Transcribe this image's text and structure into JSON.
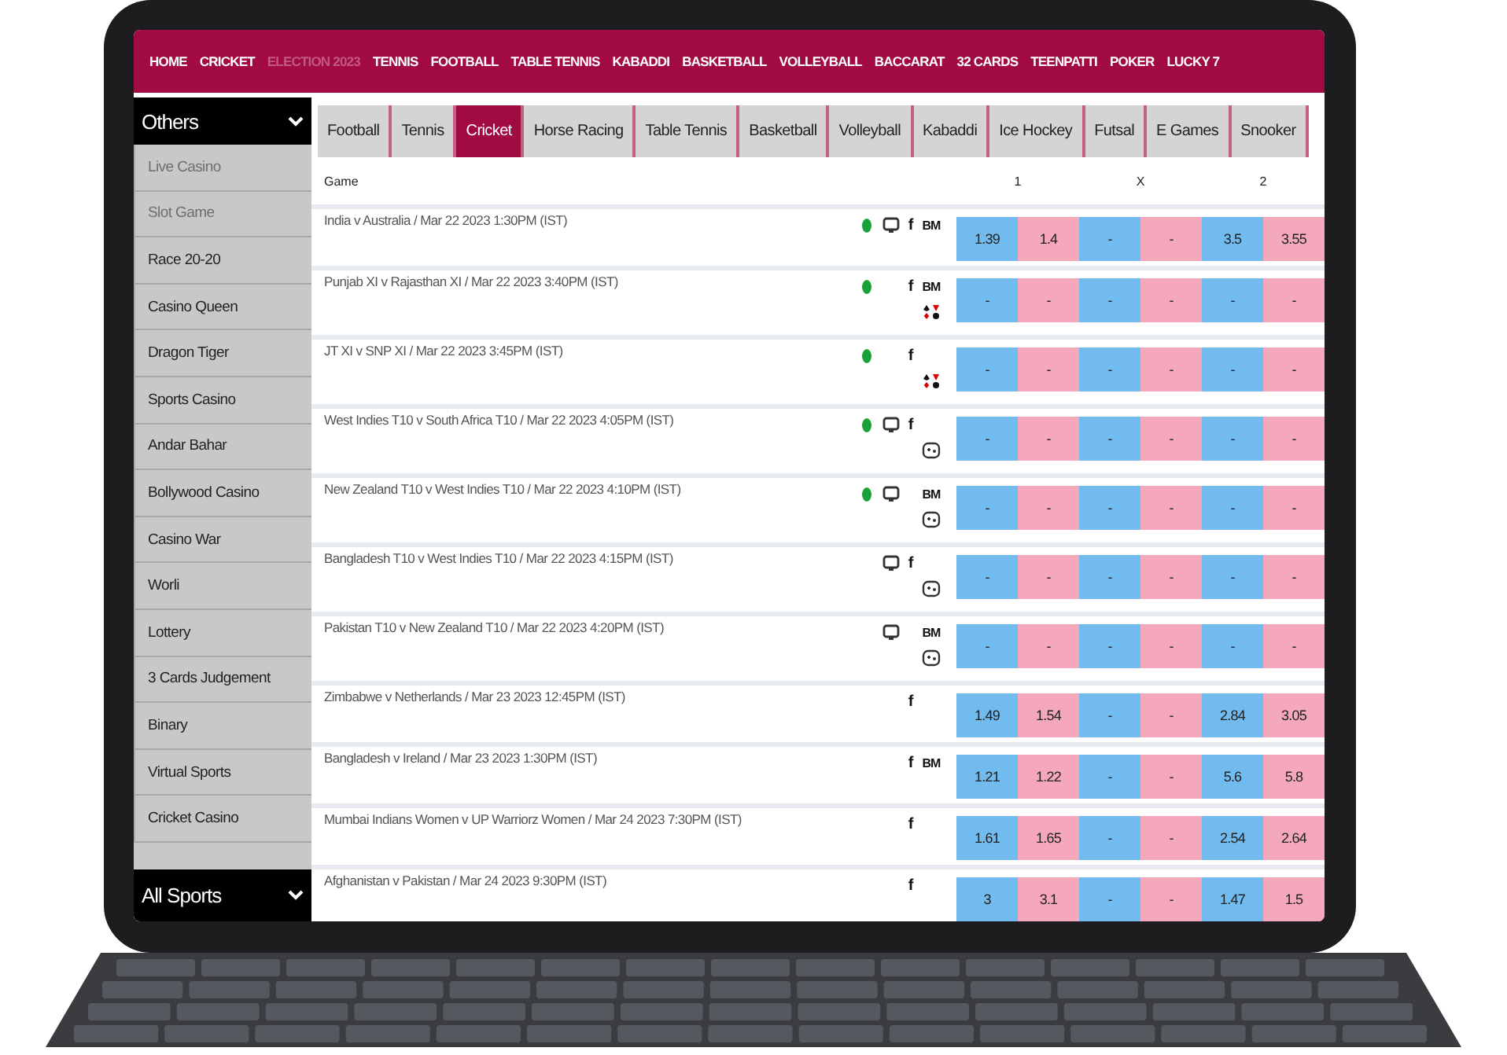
{
  "nav": [
    {
      "label": "HOME",
      "disabled": false
    },
    {
      "label": "CRICKET",
      "disabled": false
    },
    {
      "label": "ELECTION 2023",
      "disabled": true
    },
    {
      "label": "TENNIS",
      "disabled": false
    },
    {
      "label": "FOOTBALL",
      "disabled": false
    },
    {
      "label": "TABLE TENNIS",
      "disabled": false
    },
    {
      "label": "KABADDI",
      "disabled": false
    },
    {
      "label": "BASKETBALL",
      "disabled": false
    },
    {
      "label": "VOLLEYBALL",
      "disabled": false
    },
    {
      "label": "BACCARAT",
      "disabled": false
    },
    {
      "label": "32 CARDS",
      "disabled": false
    },
    {
      "label": "TEENPATTI",
      "disabled": false
    },
    {
      "label": "POKER",
      "disabled": false
    },
    {
      "label": "LUCKY 7",
      "disabled": false
    }
  ],
  "sidebar": {
    "others_header": "Others",
    "items": [
      {
        "label": "Live Casino",
        "disabled": true
      },
      {
        "label": "Slot Game",
        "disabled": true
      },
      {
        "label": "Race 20-20",
        "disabled": false
      },
      {
        "label": "Casino Queen",
        "disabled": false
      },
      {
        "label": "Dragon Tiger",
        "disabled": false
      },
      {
        "label": "Sports Casino",
        "disabled": false
      },
      {
        "label": "Andar Bahar",
        "disabled": false
      },
      {
        "label": "Bollywood Casino",
        "disabled": false
      },
      {
        "label": "Casino War",
        "disabled": false
      },
      {
        "label": "Worli",
        "disabled": false
      },
      {
        "label": "Lottery",
        "disabled": false
      },
      {
        "label": "3 Cards Judgement",
        "disabled": false
      },
      {
        "label": "Binary",
        "disabled": false
      },
      {
        "label": "Virtual Sports",
        "disabled": false
      },
      {
        "label": "Cricket Casino",
        "disabled": false
      }
    ],
    "all_sports_header": "All Sports"
  },
  "tabs": [
    {
      "label": "Football",
      "selected": false
    },
    {
      "label": "Tennis",
      "selected": false
    },
    {
      "label": "Cricket",
      "selected": true
    },
    {
      "label": "Horse Racing",
      "selected": false
    },
    {
      "label": "Table Tennis",
      "selected": false
    },
    {
      "label": "Basketball",
      "selected": false
    },
    {
      "label": "Volleyball",
      "selected": false
    },
    {
      "label": "Kabaddi",
      "selected": false
    },
    {
      "label": "Ice Hockey",
      "selected": false
    },
    {
      "label": "Futsal",
      "selected": false
    },
    {
      "label": "E Games",
      "selected": false
    },
    {
      "label": "Snooker",
      "selected": false
    }
  ],
  "table": {
    "columns": [
      "Game",
      "1",
      "X",
      "2"
    ],
    "rows": [
      {
        "match": "India v Australia / Mar 22 2023 1:30PM (IST)",
        "live": true,
        "tv": true,
        "fancy": "f",
        "bookmaker": "BM",
        "cards": false,
        "game": false,
        "odds": [
          "1.39",
          "1.4",
          "-",
          "-",
          "3.5",
          "3.55"
        ]
      },
      {
        "match": "Punjab XI v Rajasthan XI / Mar 22 2023 3:40PM (IST)",
        "live": true,
        "tv": false,
        "fancy": "f",
        "bookmaker": "BM",
        "cards": true,
        "game": false,
        "odds": [
          "-",
          "-",
          "-",
          "-",
          "-",
          "-"
        ]
      },
      {
        "match": "JT XI v SNP XI / Mar 22 2023 3:45PM (IST)",
        "live": true,
        "tv": false,
        "fancy": "f",
        "cards": true,
        "game": false,
        "odds": [
          "-",
          "-",
          "-",
          "-",
          "-",
          "-"
        ]
      },
      {
        "match": "West Indies T10 v South Africa T10 / Mar 22 2023 4:05PM (IST)",
        "live": true,
        "tv": true,
        "fancy": "f",
        "cards": false,
        "game": true,
        "odds": [
          "-",
          "-",
          "-",
          "-",
          "-",
          "-"
        ]
      },
      {
        "match": "New Zealand T10 v West Indies T10 / Mar 22 2023 4:10PM (IST)",
        "live": true,
        "tv": true,
        "bookmaker": "BM",
        "cards": false,
        "game": true,
        "odds": [
          "-",
          "-",
          "-",
          "-",
          "-",
          "-"
        ]
      },
      {
        "match": "Bangladesh T10 v West Indies T10 / Mar 22 2023 4:15PM (IST)",
        "live": false,
        "tv": true,
        "fancy": "f",
        "cards": false,
        "game": true,
        "odds": [
          "-",
          "-",
          "-",
          "-",
          "-",
          "-"
        ]
      },
      {
        "match": "Pakistan T10 v New Zealand T10 / Mar 22 2023 4:20PM (IST)",
        "live": false,
        "tv": true,
        "bookmaker": "BM",
        "cards": false,
        "game": true,
        "odds": [
          "-",
          "-",
          "-",
          "-",
          "-",
          "-"
        ]
      },
      {
        "match": "Zimbabwe v Netherlands / Mar 23 2023 12:45PM (IST)",
        "live": false,
        "tv": false,
        "fancy": "f",
        "cards": false,
        "game": false,
        "odds": [
          "1.49",
          "1.54",
          "-",
          "-",
          "2.84",
          "3.05"
        ]
      },
      {
        "match": "Bangladesh v Ireland / Mar 23 2023 1:30PM (IST)",
        "live": false,
        "tv": false,
        "fancy": "f",
        "bookmaker": "BM",
        "cards": false,
        "game": false,
        "odds": [
          "1.21",
          "1.22",
          "-",
          "-",
          "5.6",
          "5.8"
        ]
      },
      {
        "match": "Mumbai Indians Women v UP Warriorz Women / Mar 24 2023 7:30PM (IST)",
        "live": false,
        "tv": false,
        "fancy": "f",
        "cards": false,
        "game": false,
        "odds": [
          "1.61",
          "1.65",
          "-",
          "-",
          "2.54",
          "2.64"
        ]
      },
      {
        "match": "Afghanistan v Pakistan / Mar 24 2023 9:30PM (IST)",
        "live": false,
        "tv": false,
        "fancy": "f",
        "cards": false,
        "game": false,
        "odds": [
          "3",
          "3.1",
          "-",
          "-",
          "1.47",
          "1.5"
        ]
      }
    ]
  }
}
